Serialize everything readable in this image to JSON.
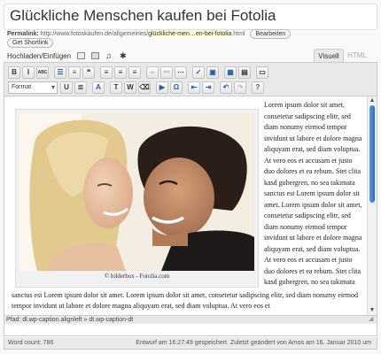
{
  "post_title": "Glückliche Menschen kaufen bei Fotolia",
  "permalink": {
    "label": "Permalink:",
    "base": "http://www.fotoskaufen.de/allgemeines/",
    "slug": "glückliche-men…en-bei-fotolia",
    "suffix": ".html",
    "edit_label": "Bearbeiten",
    "shortlink_label": "Get Shortlink"
  },
  "media": {
    "label": "Hochladen/Einfügen",
    "icons": [
      "image-icon",
      "video-icon",
      "audio-icon",
      "media-icon"
    ]
  },
  "tabs": {
    "visual": "Visuell",
    "html": "HTML"
  },
  "toolbar": {
    "row1": [
      {
        "icon": "bold-icon",
        "glyph": "B"
      },
      {
        "icon": "italic-icon",
        "glyph": "I"
      },
      {
        "icon": "strikethrough-icon",
        "glyph": "ABC"
      },
      {
        "icon": "bullet-list-icon",
        "glyph": "☰"
      },
      {
        "icon": "numbered-list-icon",
        "glyph": "≡"
      },
      {
        "icon": "blockquote-icon",
        "glyph": "❝"
      },
      {
        "icon": "align-left-icon",
        "glyph": "≡"
      },
      {
        "icon": "align-center-icon",
        "glyph": "≡"
      },
      {
        "icon": "align-right-icon",
        "glyph": "≡"
      },
      {
        "icon": "insert-link-icon",
        "glyph": "∞"
      },
      {
        "icon": "unlink-icon",
        "glyph": "⚯"
      },
      {
        "icon": "more-tag-icon",
        "glyph": "⋯"
      },
      {
        "icon": "spellcheck-icon",
        "glyph": "✓"
      },
      {
        "icon": "fullscreen-icon",
        "glyph": "▣"
      },
      {
        "icon": "kitchen-sink-icon",
        "glyph": "▦"
      },
      {
        "icon": "toggle-html-icon",
        "glyph": "▤"
      },
      {
        "icon": "note-icon",
        "glyph": "▭"
      }
    ],
    "format_select": "Format",
    "row2": [
      {
        "icon": "underline-icon",
        "glyph": "U"
      },
      {
        "icon": "justify-icon",
        "glyph": "≣"
      },
      {
        "icon": "text-color-icon",
        "glyph": "A"
      },
      {
        "icon": "paste-text-icon",
        "glyph": "T"
      },
      {
        "icon": "paste-word-icon",
        "glyph": "W"
      },
      {
        "icon": "remove-format-icon",
        "glyph": "⌫"
      },
      {
        "icon": "insert-media-icon",
        "glyph": "▶"
      },
      {
        "icon": "special-char-icon",
        "glyph": "Ω"
      },
      {
        "icon": "outdent-icon",
        "glyph": "⇤"
      },
      {
        "icon": "indent-icon",
        "glyph": "⇥"
      },
      {
        "icon": "undo-icon",
        "glyph": "↶"
      },
      {
        "icon": "redo-icon",
        "glyph": "↷"
      },
      {
        "icon": "help-icon",
        "glyph": "?"
      }
    ]
  },
  "content": {
    "image_caption": "© bilderbox - Fotolia.com",
    "body_text_side": "Lorem ipsum dolor sit amet, consetetur sadipscing elitr, sed diam nonumy eirmod tempor invidunt ut labore et dolore magna aliquyam erat, sed diam voluptua. At vero eos et accusam et justo duo dolores et ea rebum. Stet clita kasd gubergren, no sea takimata sanctus est Lorem ipsum dolor sit amet. Lorem ipsum dolor sit amet, consetetur sadipscing elitr, sed diam nonumy eirmod tempor invidunt ut labore et dolore magna aliquyam erat, sed diam voluptua. At vero eos et accusam et justo duo dolores et ea rebum. Stet clita kasd gubergren, no sea takimata",
    "body_text_full": "sanctus est Lorem ipsum dolor sit amet. Lorem ipsum dolor sit amet, consetetur sadipscing elitr, sed diam nonumy eirmod tempor invidunt ut labore et dolore magna aliquyam erat, sed diam voluptua. At vero eos et"
  },
  "path_bar": "Pfad: dl.wp-caption.alignleft » dt.wp-caption-dt",
  "status": {
    "word_count": "Word count: 786",
    "saved_note": "Entwurf am 16:27:49 gespeichert. Zuletzt geändert von Amos am 16. Januar 2010 um"
  },
  "colors": {
    "slug_highlight": "#fffbcc",
    "scroll_thumb": "#2c6dc4",
    "toolbar_bg": "#e9e9e9"
  }
}
